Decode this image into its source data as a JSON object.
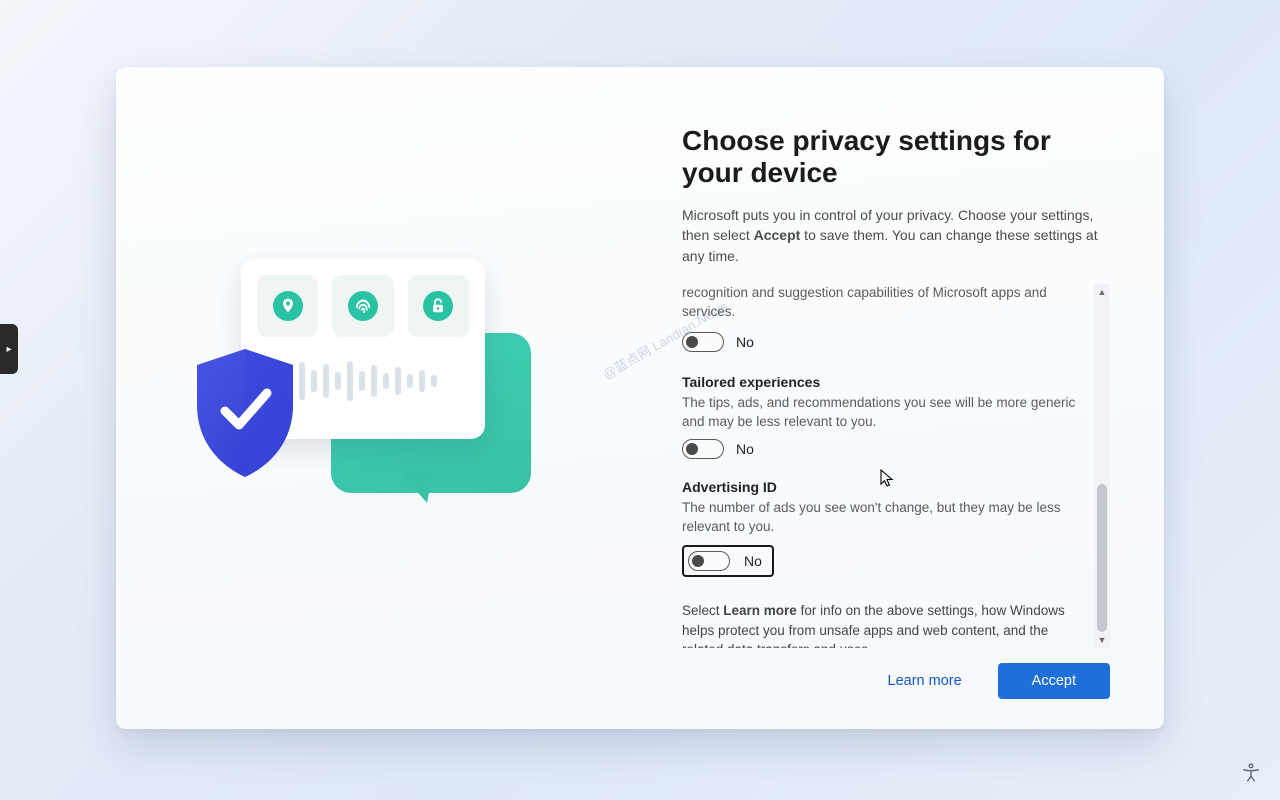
{
  "title": "Choose privacy settings for your device",
  "subtitle_pre": "Microsoft puts you in control of your privacy. Choose your settings, then select ",
  "subtitle_bold": "Accept",
  "subtitle_post": " to save them. You can change these settings at any time.",
  "partial_top_desc": "recognition and suggestion capabilities of Microsoft apps and services.",
  "toggle_labels": {
    "no": "No"
  },
  "settings": {
    "tailored": {
      "title": "Tailored experiences",
      "desc": "The tips, ads, and recommendations you see will be more generic and may be less relevant to you.",
      "state": "No"
    },
    "adid": {
      "title": "Advertising ID",
      "desc": "The number of ads you see won't change, but they may be less relevant to you.",
      "state": "No"
    }
  },
  "info_pre": "Select ",
  "info_bold": "Learn more",
  "info_post": " for info on the above settings, how Windows helps protect you from unsafe apps and web content, and the related data transfers and uses.",
  "footer": {
    "learn_more": "Learn more",
    "accept": "Accept"
  },
  "watermark": "@蓝点网 Landian.News",
  "side_tab_glyph": "▸"
}
